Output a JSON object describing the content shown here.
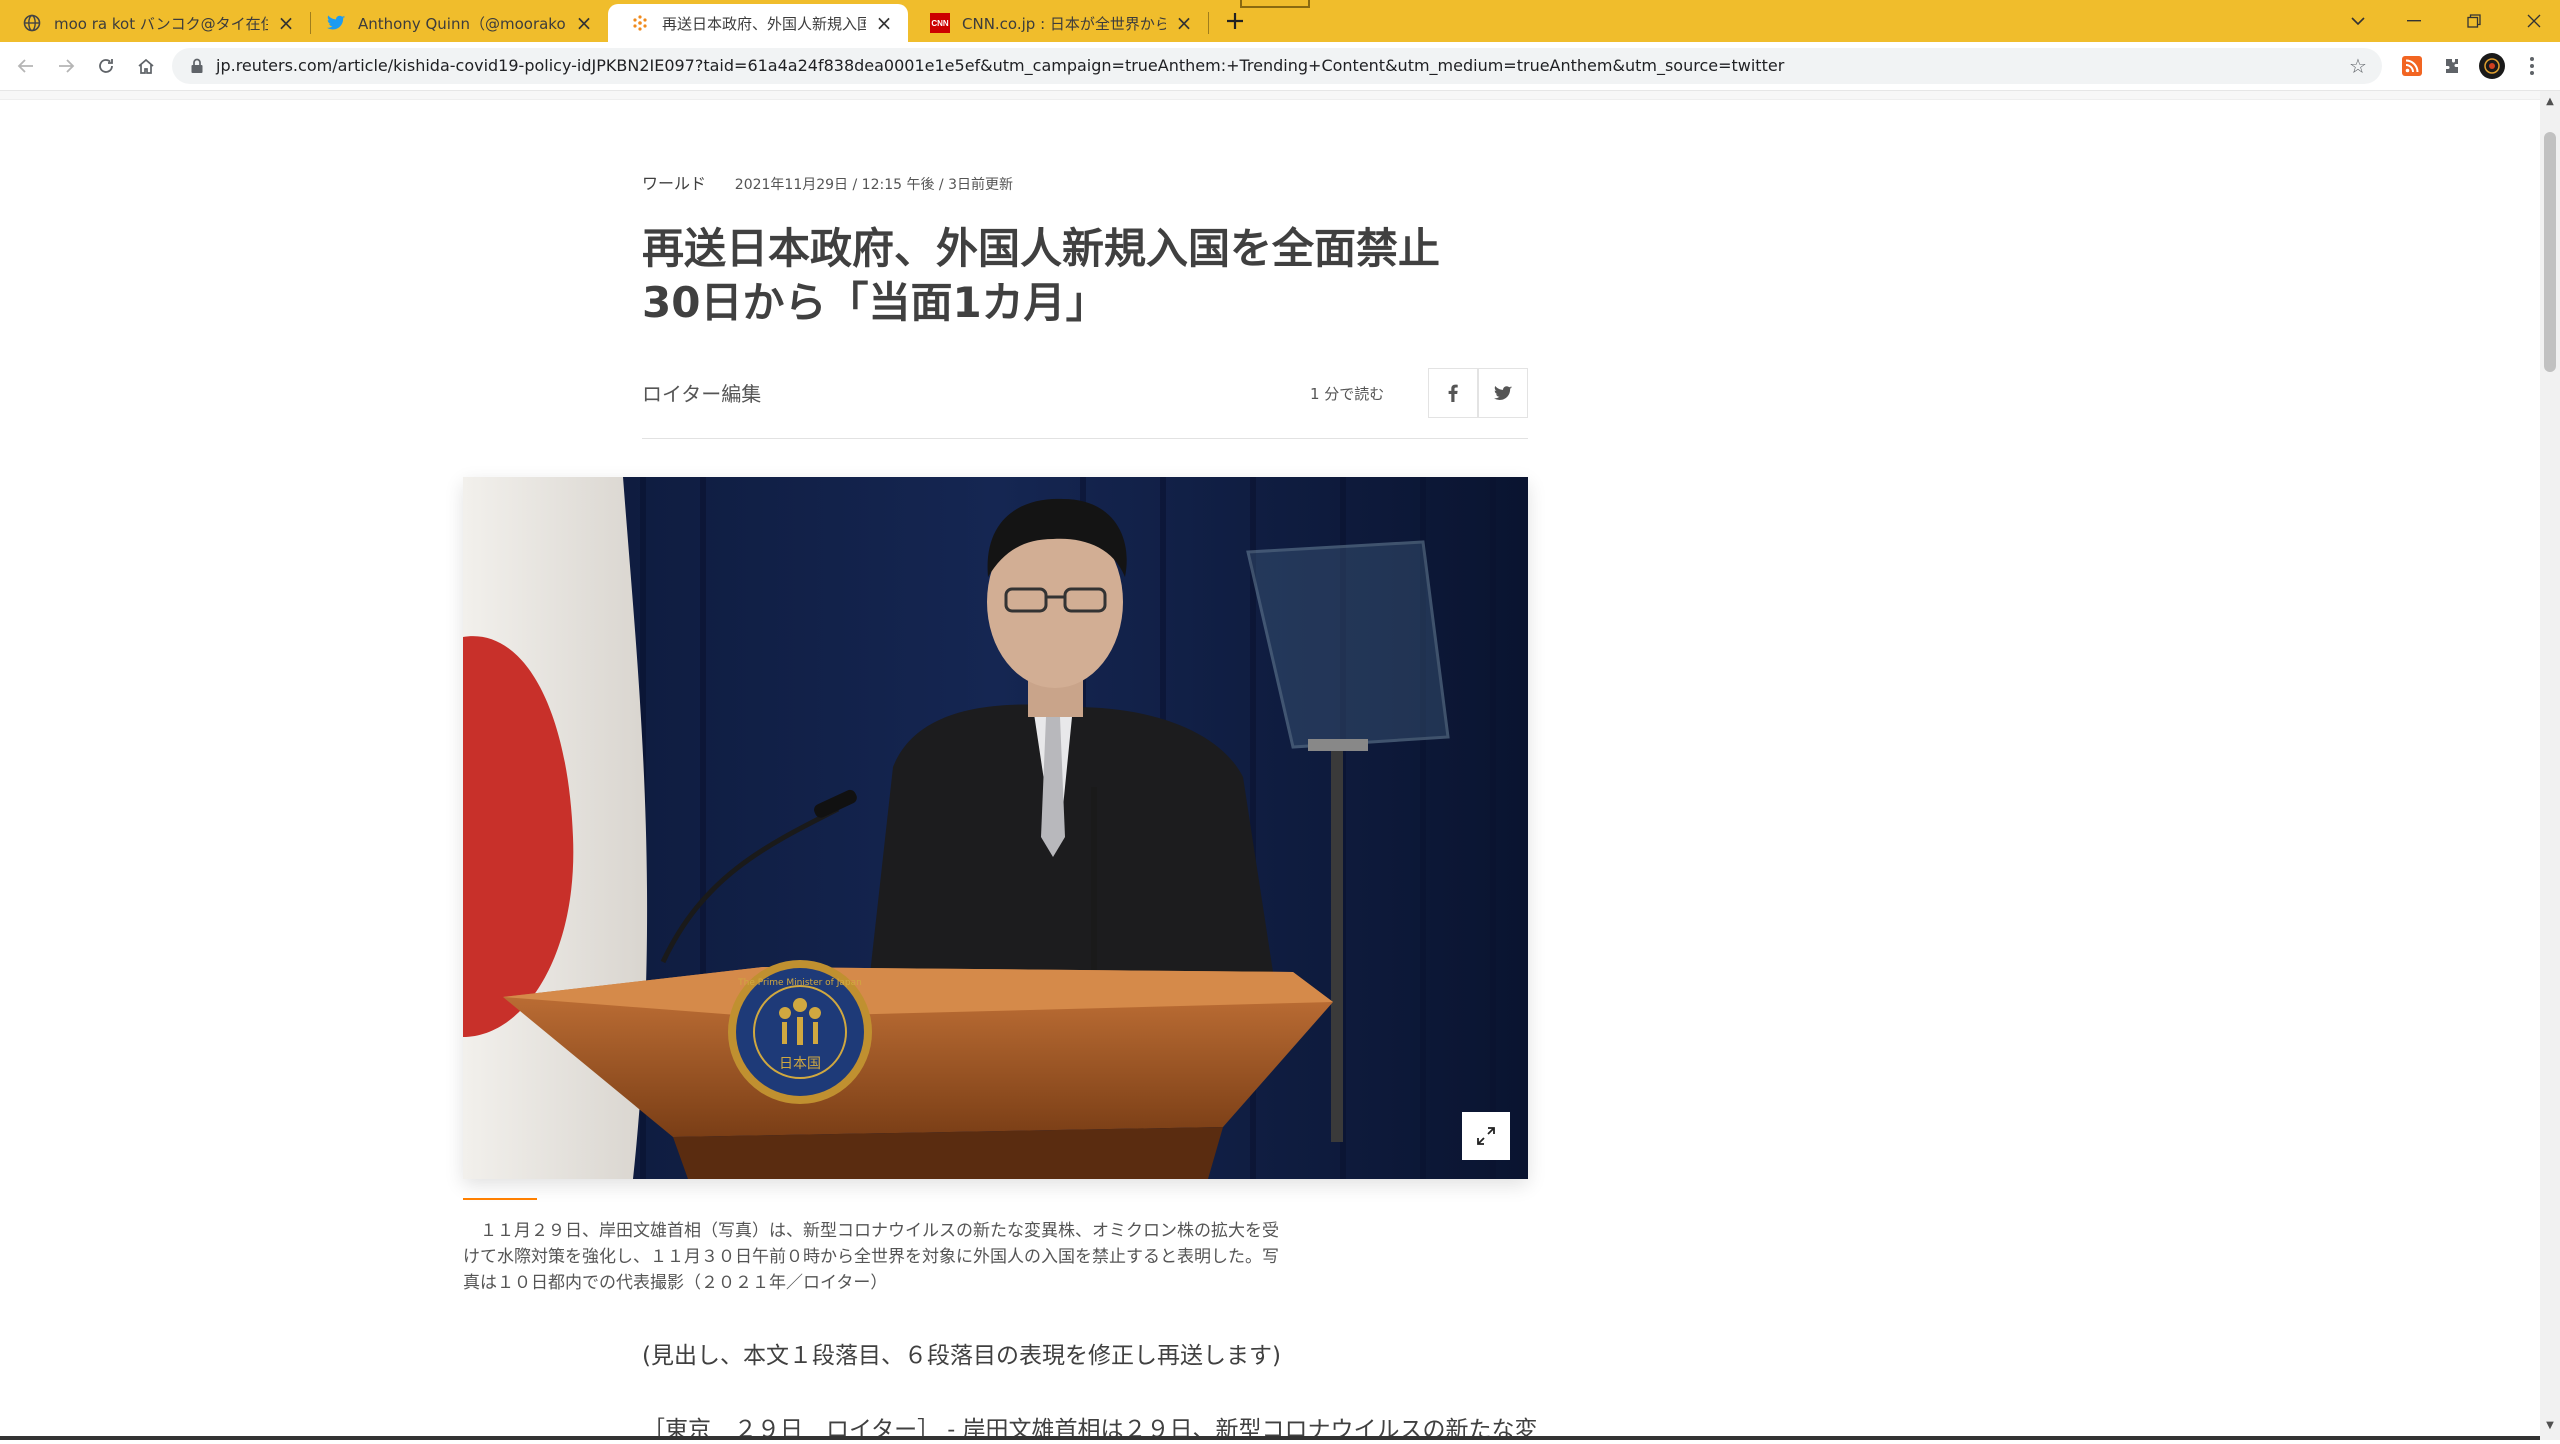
{
  "browser": {
    "tabs": [
      {
        "title": "moo ra kot バンコク@タイ在住／非",
        "favicon": "globe-icon",
        "active": false
      },
      {
        "title": "Anthony Quinn（@moorakot）さ",
        "favicon": "twitter-icon",
        "active": false
      },
      {
        "title": "再送日本政府、外国人新規入国を",
        "favicon": "reuters-icon",
        "active": true
      },
      {
        "title": "CNN.co.jp : 日本が全世界からの外",
        "favicon": "cnn-icon",
        "active": false
      }
    ],
    "cnn_favicon_text": "CNN",
    "url": "jp.reuters.com/article/kishida-covid19-policy-idJPKBN2IE097?taid=61a4a24f838dea0001e1e5ef&utm_campaign=trueAnthem:+Trending+Content&utm_medium=trueAnthem&utm_source=twitter",
    "accent_color": "#f0bd2c"
  },
  "article": {
    "category": "ワールド",
    "date": "2021年11月29日 / 12:15 午後 / 3日前更新",
    "headline_line1": "再送日本政府、外国人新規入国を全面禁止",
    "headline_line2": "30日から「当面1カ月」",
    "author": "ロイター編集",
    "read_time": "1 分で読む",
    "caption": "　１１月２９日、岸田文雄首相（写真）は、新型コロナウイルスの新たな変異株、オミクロン株の拡大を受けて水際対策を強化し、１１月３０日午前０時から全世界を対象に外国人の入国を禁止すると表明した。写真は１０日都内での代表撮影（２０２１年／ロイター）",
    "correction_note": "(見出し、本文１段落目、６段落目の表現を修正し再送します)",
    "first_paragraph": "［東京　２９日　ロイター］ - 岸田文雄首相は２９日、新型コロナウイルスの新たな変",
    "emblem_text": "日本国",
    "emblem_ring_text": "The Prime Minister of Japan"
  }
}
